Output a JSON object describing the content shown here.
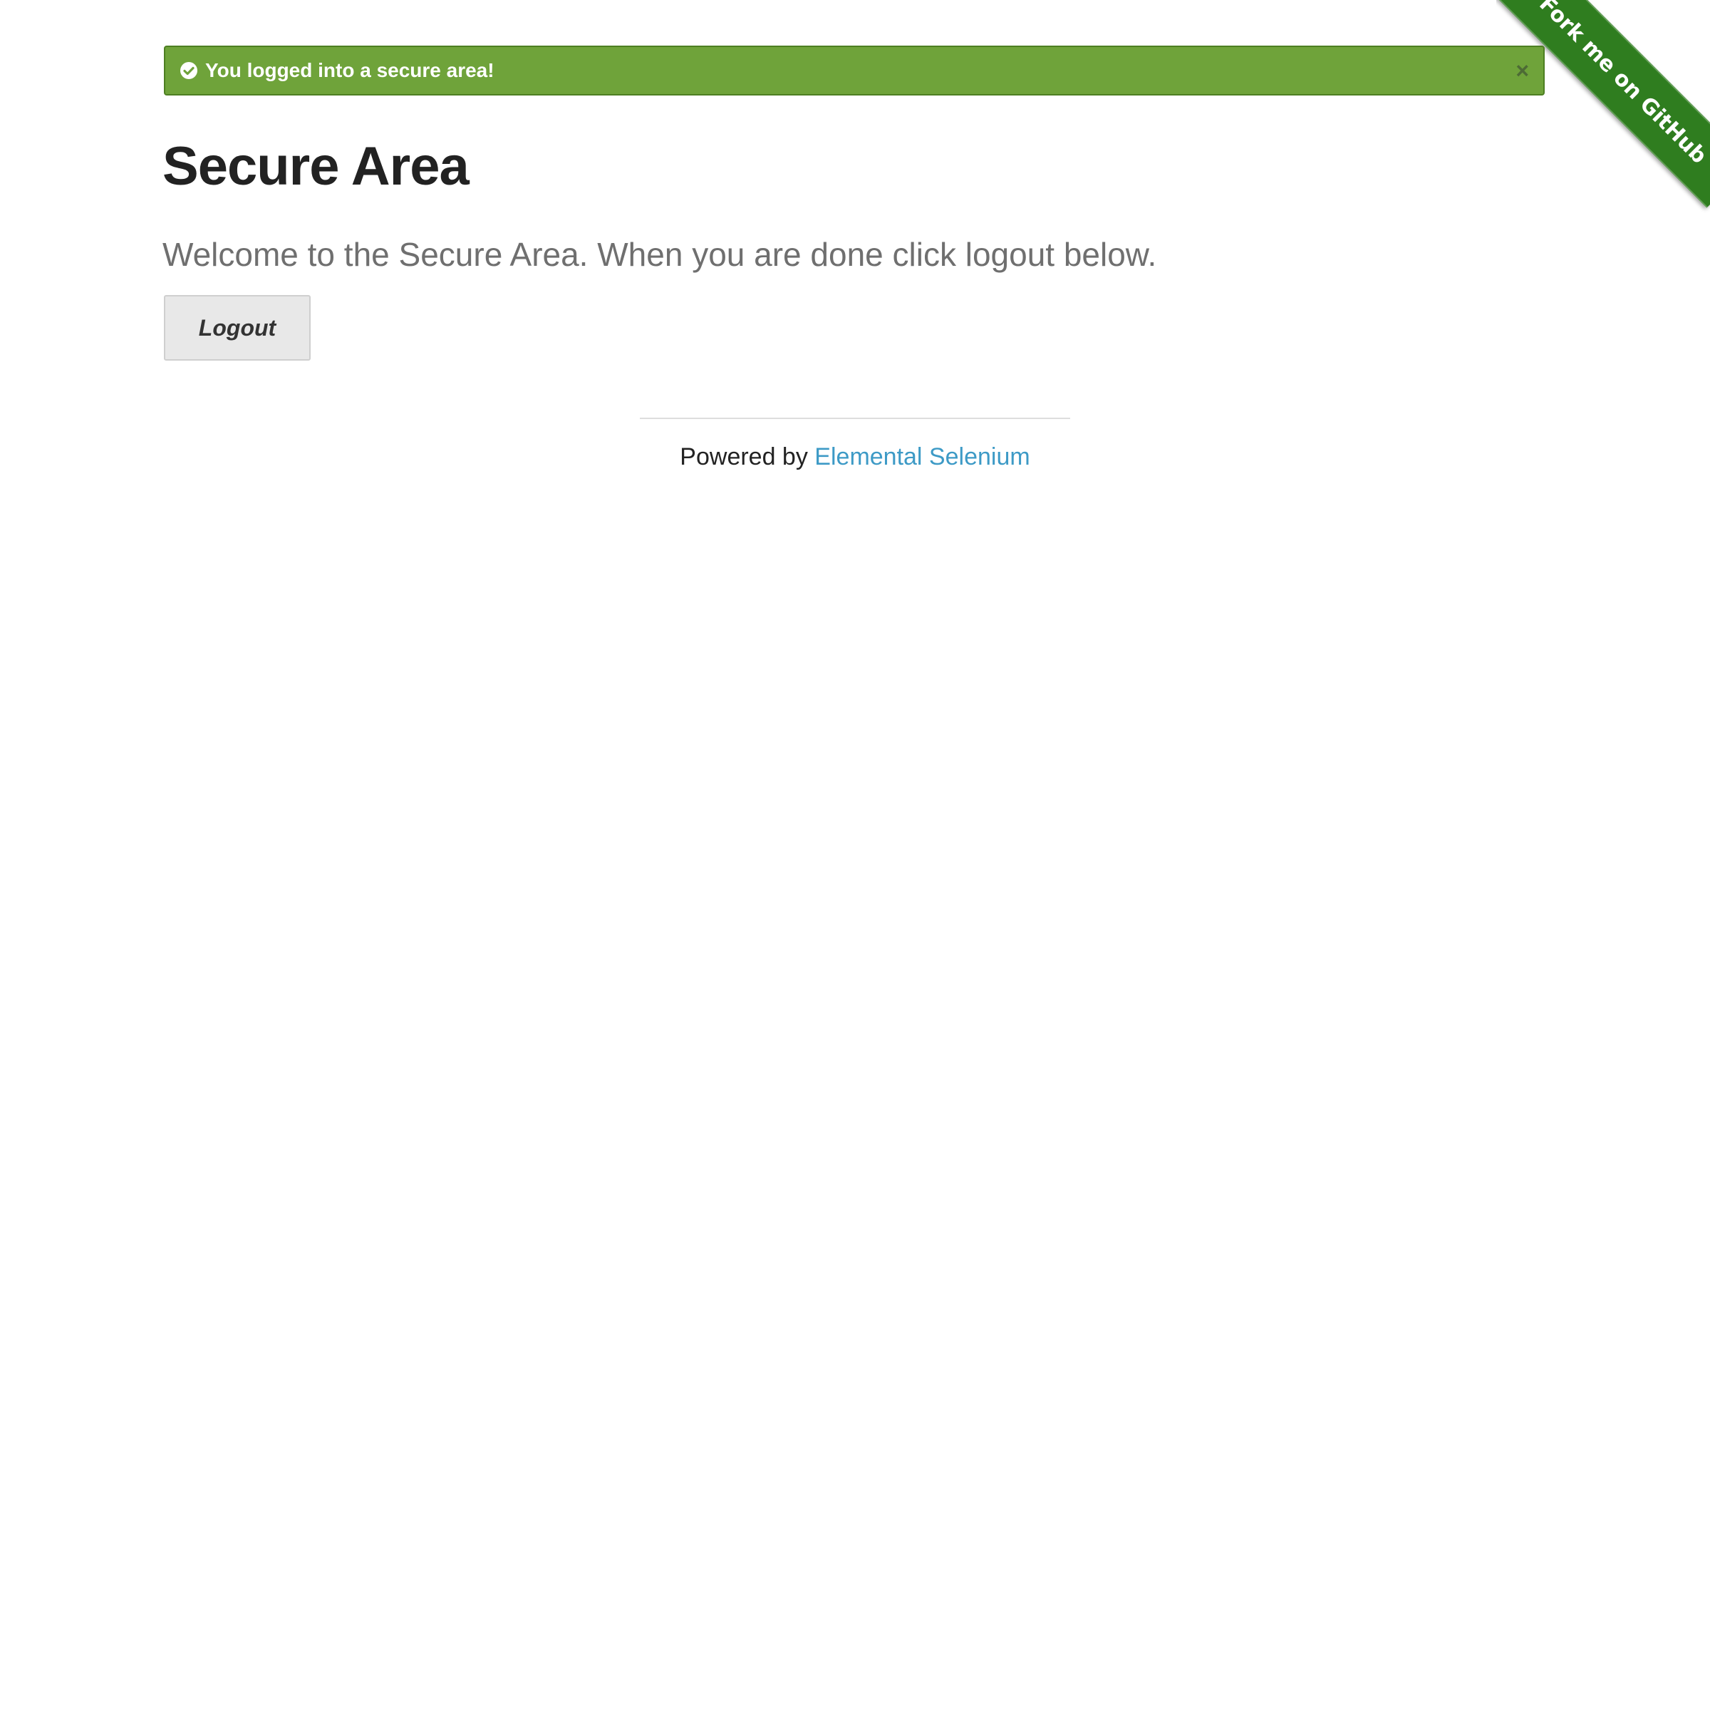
{
  "ribbon": {
    "label": "Fork me on GitHub"
  },
  "flash": {
    "message": "You logged into a secure area!",
    "close_label": "×",
    "icon": "check-circle-icon",
    "color": "#6fa33a"
  },
  "main": {
    "title": "Secure Area",
    "subheader": "Welcome to the Secure Area. When you are done click logout below.",
    "logout_label": "Logout"
  },
  "footer": {
    "prefix": "Powered by ",
    "link_label": "Elemental Selenium",
    "link_color": "#3d9ac6"
  }
}
